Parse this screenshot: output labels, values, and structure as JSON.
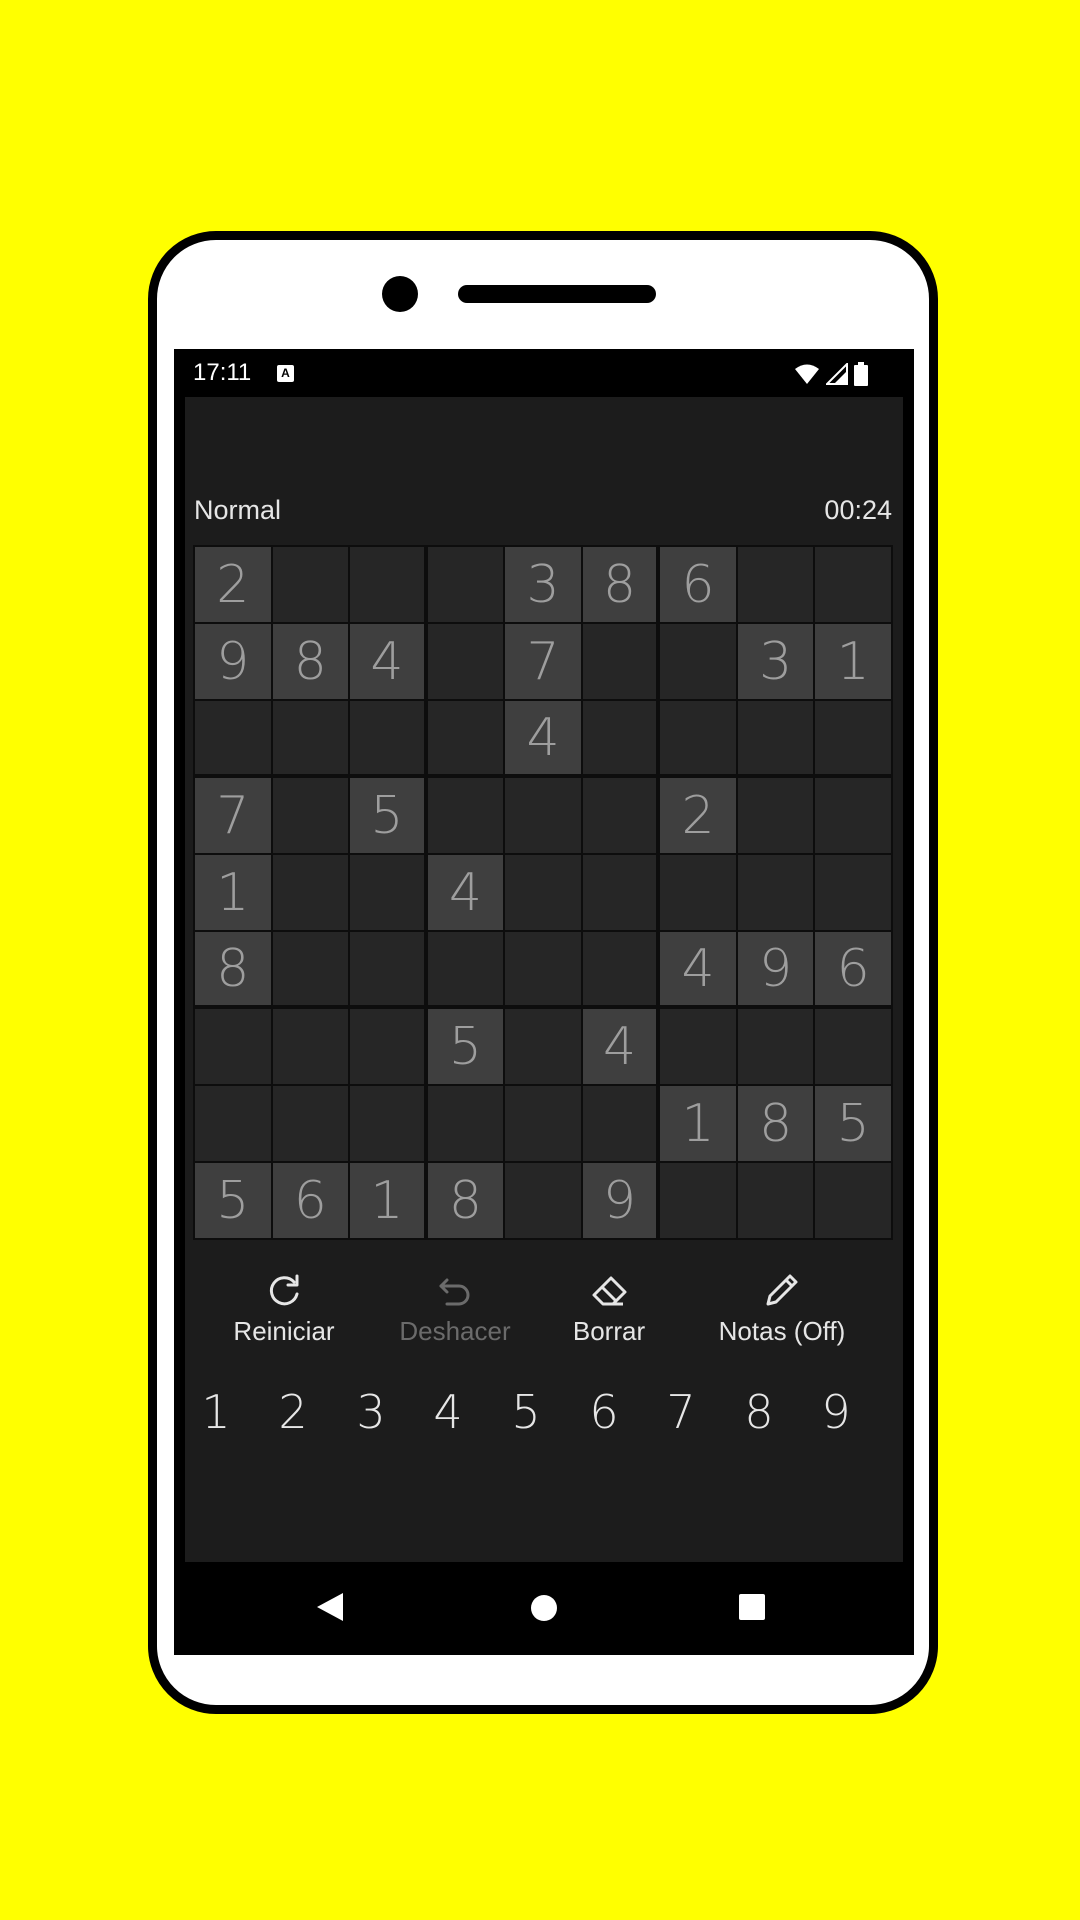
{
  "status_bar": {
    "time": "17:11",
    "notification_icon": "a-badge-icon",
    "icons": [
      "wifi-icon",
      "cell-signal-icon",
      "battery-icon"
    ]
  },
  "game": {
    "difficulty": "Normal",
    "timer": "00:24",
    "grid": [
      [
        "2",
        "",
        "",
        "",
        "3",
        "8",
        "6",
        "",
        ""
      ],
      [
        "9",
        "8",
        "4",
        "",
        "7",
        "",
        "",
        "3",
        "1"
      ],
      [
        "",
        "",
        "",
        "",
        "4",
        "",
        "",
        "",
        ""
      ],
      [
        "7",
        "",
        "5",
        "",
        "",
        "",
        "2",
        "",
        ""
      ],
      [
        "1",
        "",
        "",
        "4",
        "",
        "",
        "",
        "",
        ""
      ],
      [
        "8",
        "",
        "",
        "",
        "",
        "",
        "4",
        "9",
        "6"
      ],
      [
        "",
        "",
        "",
        "5",
        "",
        "4",
        "",
        "",
        ""
      ],
      [
        "",
        "",
        "",
        "",
        "",
        "",
        "1",
        "8",
        "5"
      ],
      [
        "5",
        "6",
        "1",
        "8",
        "",
        "9",
        "",
        "",
        ""
      ]
    ]
  },
  "actions": {
    "restart": {
      "label": "Reiniciar",
      "icon": "refresh-icon"
    },
    "undo": {
      "label": "Deshacer",
      "icon": "undo-icon"
    },
    "erase": {
      "label": "Borrar",
      "icon": "eraser-icon"
    },
    "notes": {
      "label": "Notas (Off)",
      "icon": "pencil-icon"
    }
  },
  "numpad": [
    "1",
    "2",
    "3",
    "4",
    "5",
    "6",
    "7",
    "8",
    "9"
  ],
  "nav": {
    "back": "back-icon",
    "home": "home-icon",
    "recents": "recents-icon"
  },
  "colors": {
    "background": "#ffff00",
    "app_bg": "#1c1c1c",
    "given_cell": "#3f3f3f",
    "empty_cell": "#262626",
    "disabled_text": "#6b6b6b"
  }
}
